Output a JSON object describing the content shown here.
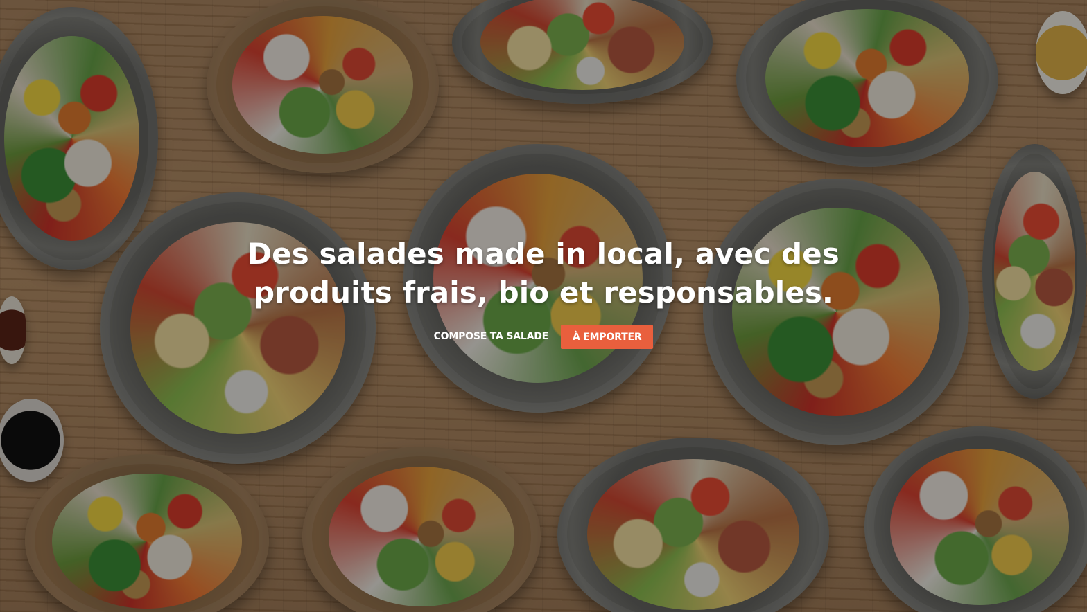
{
  "hero": {
    "headline_line1": "Des salades made in local, avec des",
    "headline_line2": "produits frais, bio et responsables.",
    "actions": {
      "compose_label": "COMPOSE TA SALADE",
      "takeaway_label": "À EMPORTER"
    },
    "accent_color": "#e95f3d",
    "background_description_icon": "salad-bowls-photo"
  }
}
